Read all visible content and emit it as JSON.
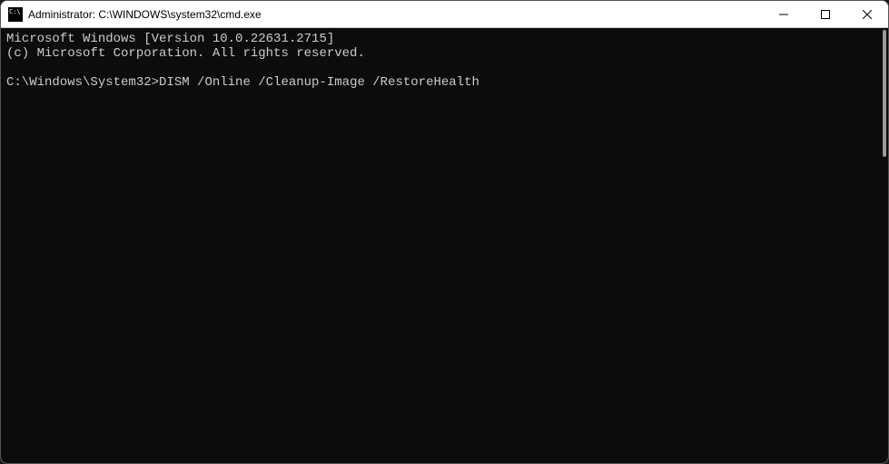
{
  "window": {
    "title": "Administrator: C:\\WINDOWS\\system32\\cmd.exe"
  },
  "terminal": {
    "line1": "Microsoft Windows [Version 10.0.22631.2715]",
    "line2": "(c) Microsoft Corporation. All rights reserved.",
    "blank": "",
    "prompt": "C:\\Windows\\System32>",
    "command": "DISM /Online /Cleanup-Image /RestoreHealth"
  },
  "icons": {
    "minimize": "minimize-icon",
    "maximize": "maximize-icon",
    "close": "close-icon"
  }
}
